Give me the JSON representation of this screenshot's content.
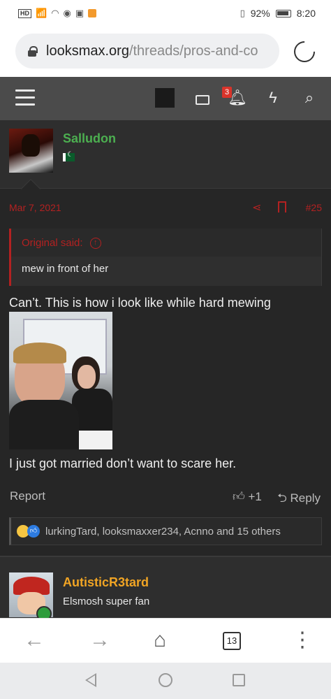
{
  "status_bar": {
    "hd": "HD",
    "network": "4G",
    "battery": "92%",
    "time": "8:20"
  },
  "browser": {
    "url_host": "looksmax.org",
    "url_path": "/threads/pros-and-co",
    "tab_count": "13"
  },
  "site_header": {
    "notification_count": "3"
  },
  "post": {
    "username": "Salludon",
    "date": "Mar 7, 2021",
    "post_number": "#25",
    "quote": {
      "attribution": "Original said:",
      "text": "mew in front of her"
    },
    "text_1": "Can’t. This is how i look like while hard mewing",
    "text_2": "I just got married don’t want to scare her.",
    "report_label": "Report",
    "like_label": "+1",
    "reply_label": "Reply",
    "reactions_text": "lurkingTard, looksmaxxer234, Acnno and 15 others"
  },
  "next_post": {
    "username": "AutisticR3tard",
    "user_title": "Elsmosh super fan"
  },
  "colors": {
    "accent_red": "#b32121",
    "username_green": "#4caf50",
    "username_orange": "#f0a424",
    "header_bg": "#4b4b4b",
    "content_bg": "#262626"
  }
}
